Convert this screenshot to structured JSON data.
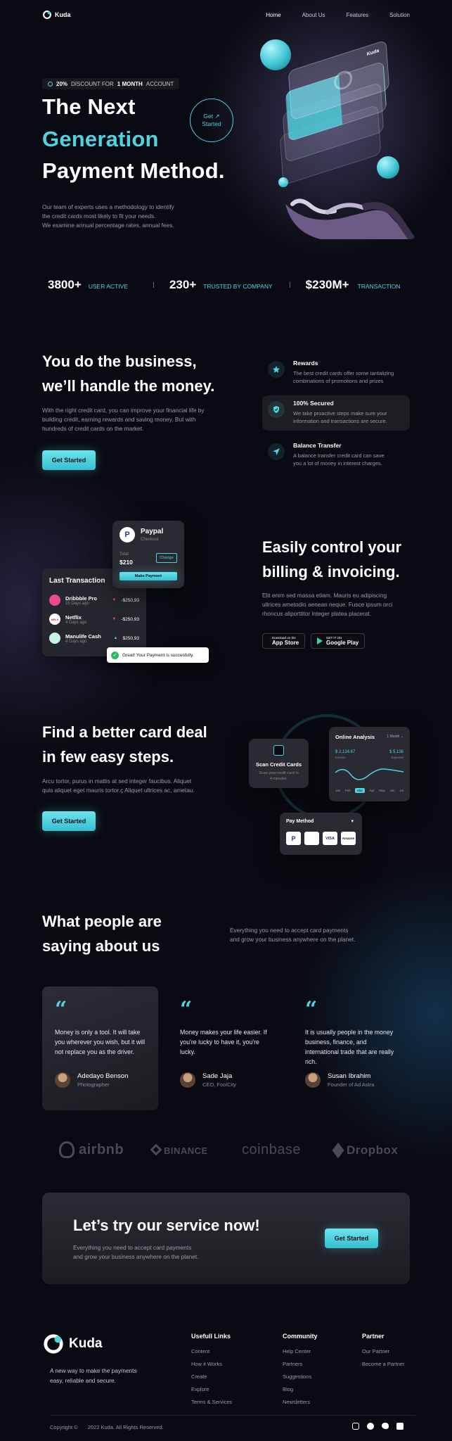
{
  "brand": {
    "name": "Kuda"
  },
  "nav": {
    "items": [
      "Home",
      "About Us",
      "Features",
      "Solution"
    ]
  },
  "hero": {
    "badge_percent": "20%",
    "badge_mid": "DISCOUNT FOR",
    "badge_bold": "1 MONTH",
    "badge_end": "ACCOUNT",
    "line1": "The Next",
    "line2": "Generation",
    "line3": "Payment Method.",
    "desc1": "Our team of experts uses a methodology to identify",
    "desc2": "the credit cards most likely to fit your needs.",
    "desc3": "We examine annual percentage rates, annual fees.",
    "cta_line1": "Get ↗",
    "cta_line2": "Started",
    "card_brand": "Kuda"
  },
  "stats": [
    {
      "value": "3800+",
      "label": "USER ACTIVE"
    },
    {
      "value": "230+",
      "label": "TRUSTED BY COMPANY"
    },
    {
      "value": "$230M+",
      "label": "TRANSACTION"
    }
  ],
  "business": {
    "title1": "You do the business,",
    "title2": "we’ll handle the money.",
    "desc1": "With the right credit card, you can improve your financial life by",
    "desc2": "building credit, earning rewards and saving money. But with",
    "desc3": "hundreds of credit cards on the market.",
    "cta": "Get Started",
    "features": [
      {
        "title": "Rewards",
        "desc1": "The best credit cards offer some tantalizing",
        "desc2": "combinations of promotions and prizes"
      },
      {
        "title": "100% Secured",
        "desc1": "We take proactive steps make sure your",
        "desc2": "information and transactions are secure."
      },
      {
        "title": "Balance Transfer",
        "desc1": "A balance transfer credit card can save",
        "desc2": "you a lot of money in interest charges."
      }
    ]
  },
  "billing": {
    "title1": "Easily control your",
    "title2": "billing & invoicing.",
    "desc1": "Elit enim sed massa etiam. Mauris eu adipiscing",
    "desc2": "ultrices ametodio aenean neque. Fusce ipsum orci",
    "desc3": "rhoncus aliporttitor integer platea placerat.",
    "appstore_small": "Download on the",
    "appstore": "App Store",
    "googleplay_small": "GET IT ON",
    "googleplay": "Google Play",
    "paypal_name": "Paypal",
    "paypal_sub": "Checkout",
    "total_label": "Total",
    "total_value": "$210",
    "change": "Change",
    "make_payment": "Make Payment",
    "last_tx_title": "Last Transaction",
    "transactions": [
      {
        "name": "Dribbble Pro",
        "date": "15 Days ago",
        "amount": "-$250,93",
        "dir": "down"
      },
      {
        "name": "Netflix",
        "date": "4 Days ago",
        "amount": "-$250,93",
        "dir": "down"
      },
      {
        "name": "Manulife Cash",
        "date": "4 Days ago",
        "amount": "$250,93",
        "dir": "up"
      }
    ],
    "toast": "Great! Your Payment is succesfully."
  },
  "steps": {
    "title1": "Find a better card deal",
    "title2": "in few easy steps.",
    "desc1": "Arcu tortor, purus in mattis at sed integer faucibus. Aliquet",
    "desc2": "quis aliquet eget mauris tortor.ç Aliquet ultrices ac, ametau.",
    "cta": "Get Started",
    "scan_title": "Scan Credit Cards",
    "scan_desc1": "Scan yourcredit card in",
    "scan_desc2": "4 minutes.",
    "analysis_title": "Online Analysis",
    "analysis_period": "1 Month",
    "analysis_v1": "$ 2,124.67",
    "analysis_l1": "Income",
    "analysis_v2": "$ 5,136",
    "analysis_l2": "Expense",
    "months": [
      "Jan",
      "Feb",
      "Mar",
      "Apr",
      "May",
      "Jun",
      "Jul"
    ],
    "active_month": "Mar",
    "pay_method": "Pay Method",
    "pay_options": [
      "P",
      "",
      "VISA",
      "Amazon"
    ]
  },
  "testimonials": {
    "title1": "What people are",
    "title2": "saying about us",
    "desc1": "Everything you need to accept card payments",
    "desc2": "and grow your business anywhere on the planet.",
    "items": [
      {
        "quote": "Money is only a tool. It will take you wherever you wish, but it will not replace you as the driver.",
        "name": "Adedayo Benson",
        "role": "Photographer"
      },
      {
        "quote": "Money makes your life easier. If you're lucky to have it, you're lucky.",
        "name": "Sade Jaja",
        "role": "CEO, FoolCity"
      },
      {
        "quote": "It is usually people in the money business, finance, and international trade that are really rich.",
        "name": "Susan Ibrahim",
        "role": "Founder of Ad Astra"
      }
    ]
  },
  "logos": [
    "airbnb",
    "BINANCE",
    "coinbase",
    "Dropbox"
  ],
  "cta_section": {
    "title": "Let’s try our service now!",
    "desc1": "Everything you need to accept card payments",
    "desc2": "and grow your business anywhere on the planet.",
    "button": "Get Started"
  },
  "footer": {
    "tagline1": "A new way to make the payments",
    "tagline2": "easy, reliable and secure.",
    "columns": [
      {
        "title": "Usefull Links",
        "links": [
          "Content",
          "How it Works",
          "Create",
          "Explore",
          "Terms & Services"
        ]
      },
      {
        "title": "Community",
        "links": [
          "Help Center",
          "Partners",
          "Suggestions",
          "Blog",
          "Newsletters"
        ]
      },
      {
        "title": "Partner",
        "links": [
          "Our Partner",
          "Become a Partner"
        ]
      }
    ],
    "copyright": "Copyright ©",
    "copyright2": "2022 Kuda. All Rights Reserved."
  }
}
